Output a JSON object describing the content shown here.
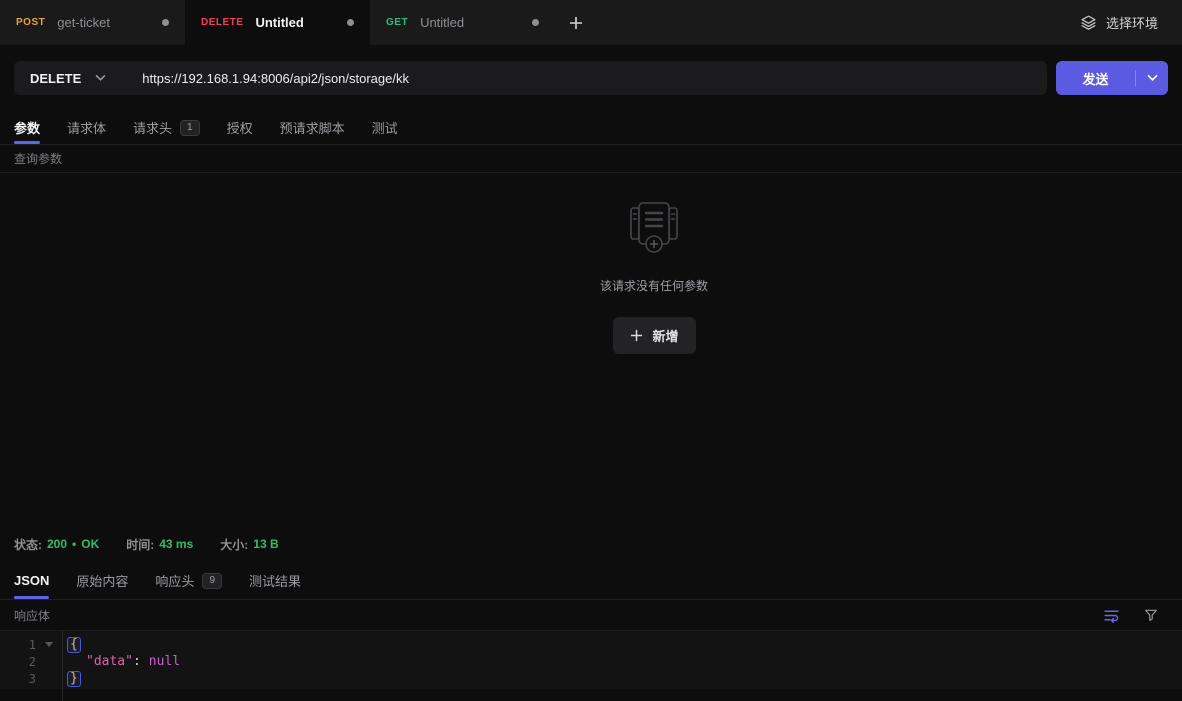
{
  "header": {
    "env_selector_label": "选择环境"
  },
  "tabs": [
    {
      "method": "POST",
      "name": "get-ticket"
    },
    {
      "method": "DELETE",
      "name": "Untitled"
    },
    {
      "method": "GET",
      "name": "Untitled"
    }
  ],
  "request": {
    "method": "DELETE",
    "url": "https://192.168.1.94:8006/api2/json/storage/kk",
    "send_label": "发送",
    "tabs": {
      "params": "参数",
      "body": "请求体",
      "headers": "请求头",
      "headers_badge": "1",
      "auth": "授权",
      "pre_request_script": "预请求脚本",
      "tests": "测试"
    },
    "section_label": "查询参数",
    "empty_message": "该请求没有任何参数",
    "add_button_label": "新增"
  },
  "response": {
    "status_label": "状态:",
    "status_code": "200",
    "status_sep": "•",
    "status_text": "OK",
    "time_label": "时间:",
    "time_value": "43 ms",
    "size_label": "大小:",
    "size_value": "13 B",
    "tabs": {
      "json": "JSON",
      "raw": "原始内容",
      "headers": "响应头",
      "headers_badge": "9",
      "test_results": "测试结果"
    },
    "section_label": "响应体",
    "editor": {
      "line_numbers": [
        "1",
        "2",
        "3"
      ],
      "tokens": {
        "open_brace": "{",
        "key": "\"data\"",
        "colon": ":",
        "value": "null",
        "close_brace": "}"
      }
    }
  },
  "colors": {
    "accent_purple": "#5b5be2",
    "method_post": "#e8a33d",
    "method_delete": "#f23e53",
    "method_get": "#2bbd7f",
    "status_green": "#2dbd6e",
    "json_key": "#dd63a9",
    "json_value": "#c95fd0",
    "bracket_gold": "#d3bc8a"
  }
}
